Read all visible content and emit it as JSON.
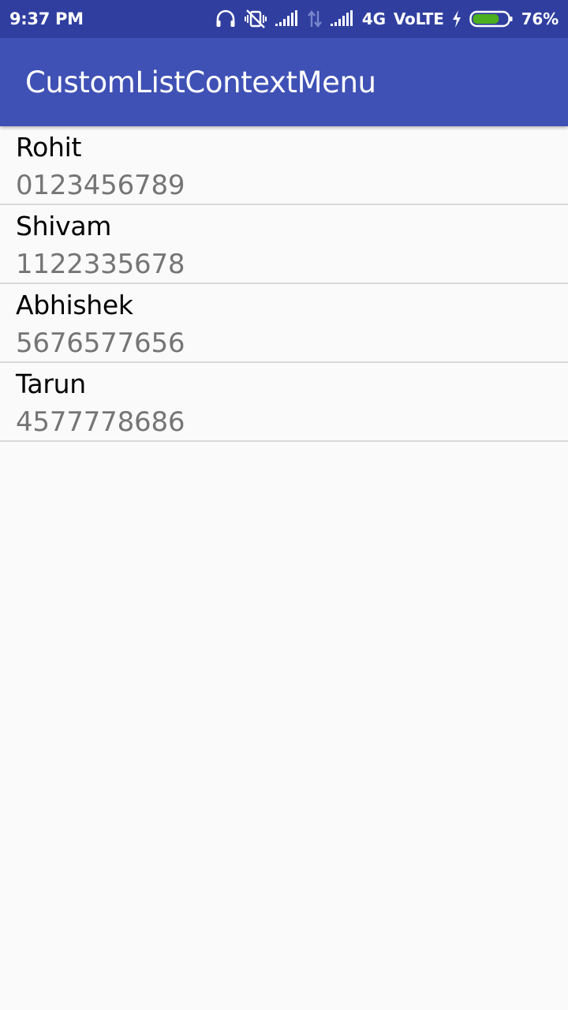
{
  "status_bar": {
    "time": "9:37 PM",
    "network_type": "4G",
    "volte": "VoLTE",
    "battery_percent": "76%",
    "battery_level": 0.76,
    "background_color": "#303f9f",
    "icons": [
      "headphones-icon",
      "vibrate-off-icon",
      "signal-icon",
      "data-arrows-icon",
      "signal-icon",
      "charging-icon",
      "battery-icon"
    ]
  },
  "app_bar": {
    "title": "CustomListContextMenu",
    "background_color": "#3f51b5"
  },
  "contacts": [
    {
      "name": "Rohit",
      "number": "0123456789"
    },
    {
      "name": "Shivam",
      "number": "1122335678"
    },
    {
      "name": "Abhishek",
      "number": "5676577656"
    },
    {
      "name": "Tarun",
      "number": "4577778686"
    }
  ]
}
